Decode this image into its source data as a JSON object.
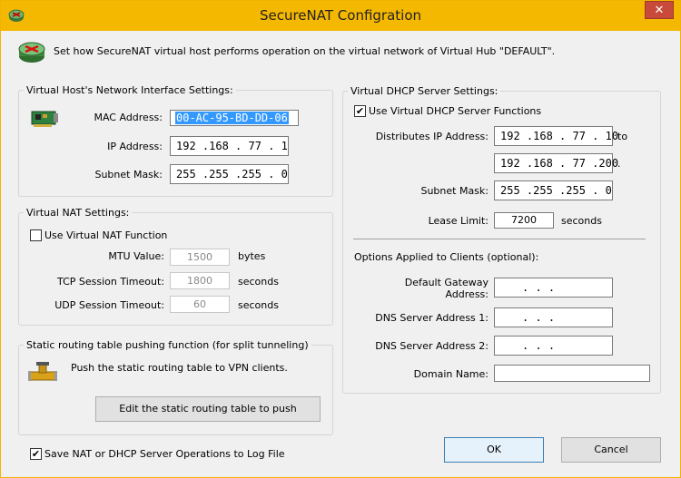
{
  "window": {
    "title": "SecureNAT Configration",
    "close_glyph": "✕",
    "icon": "router-icon"
  },
  "header": {
    "text": "Set how SecureNAT virtual host performs operation on the virtual network of Virtual Hub \"DEFAULT\"."
  },
  "host_group": {
    "title": "Virtual Host's Network Interface Settings:",
    "mac_label": "MAC Address:",
    "mac_value": "00-AC-95-BD-DD-06",
    "ip_label": "IP Address:",
    "ip_value": "192 .168 . 77  .  1",
    "mask_label": "Subnet Mask:",
    "mask_value": "255 .255 .255 .  0"
  },
  "nat_group": {
    "title": "Virtual NAT Settings:",
    "use_label": "Use Virtual NAT Function",
    "mtu_label": "MTU Value:",
    "mtu_value": "1500",
    "mtu_unit": "bytes",
    "tcp_label": "TCP Session Timeout:",
    "tcp_value": "1800",
    "tcp_unit": "seconds",
    "udp_label": "UDP Session Timeout:",
    "udp_value": "60",
    "udp_unit": "seconds"
  },
  "routing_group": {
    "title": "Static routing table pushing function (for split tunneling)",
    "desc": "Push the static routing table to VPN clients.",
    "edit_button": "Edit the static routing table to push"
  },
  "log_checkbox": {
    "label": "Save NAT or DHCP Server Operations to Log File",
    "checked": true
  },
  "dhcp_group": {
    "title": "Virtual DHCP Server Settings:",
    "use_label": "Use Virtual DHCP Server Functions",
    "range_label": "Distributes IP Address:",
    "range_start": "192 .168 . 77  . 10",
    "to_label": "to",
    "range_end": "192 .168 . 77  .200",
    "range_end_suffix": ".",
    "mask_label": "Subnet Mask:",
    "mask_value": "255 .255 .255 .  0",
    "lease_label": "Lease Limit:",
    "lease_value": "7200",
    "lease_unit": "seconds",
    "options_title": "Options Applied to Clients (optional):",
    "gateway_label_1": "Default Gateway",
    "gateway_label_2": "Address:",
    "gateway_value": ".     .     .",
    "dns1_label": "DNS Server Address 1:",
    "dns1_value": ".     .     .",
    "dns2_label": "DNS Server Address 2:",
    "dns2_value": ".     .     .",
    "domain_label": "Domain Name:",
    "domain_value": ""
  },
  "buttons": {
    "ok": "OK",
    "cancel": "Cancel"
  },
  "check_glyph": "✔"
}
